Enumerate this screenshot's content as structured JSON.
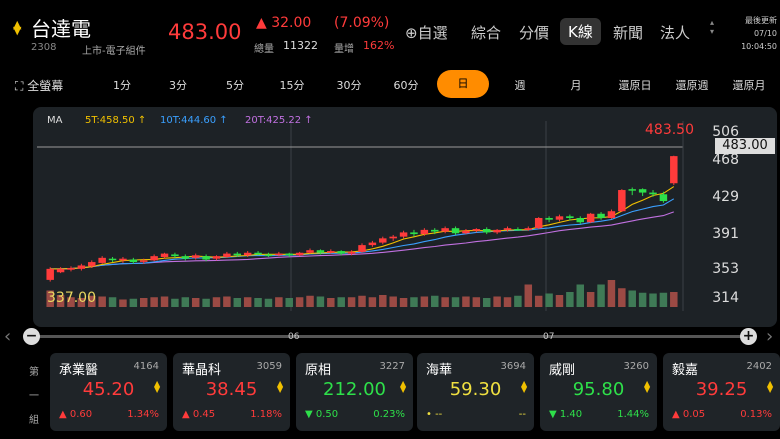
{
  "header": {
    "name": "台達電",
    "code": "2308",
    "market": "上市-電子組件",
    "price": "483.00",
    "change": "▲ 32.00",
    "change_pct": "(7.09%)",
    "volume_label": "總量",
    "volume": "11322",
    "ratio_label": "量增",
    "ratio": "162%",
    "nav": [
      "⊕自選",
      "綜合",
      "分價",
      "K線",
      "新聞",
      "法人"
    ],
    "update_label": "最後更新",
    "update_date": "07/10",
    "update_time": "10:04:50"
  },
  "timeframes": {
    "fullscreen": "全螢幕",
    "items": [
      "1分",
      "3分",
      "5分",
      "15分",
      "30分",
      "60分",
      "日",
      "週",
      "月",
      "還原日",
      "還原週",
      "還原月"
    ],
    "active": "日"
  },
  "chart_data": {
    "type": "candlestick",
    "indicator_label": "MA",
    "ma": [
      {
        "name": "5T:458.50",
        "color": "#f0c000"
      },
      {
        "name": "10T:444.60",
        "color": "#3aa0ff"
      },
      {
        "name": "20T:425.22",
        "color": "#c070e0"
      }
    ],
    "y_ticks": [
      506,
      468,
      429,
      391,
      353,
      314
    ],
    "ylim": [
      305,
      515
    ],
    "current_price": "483.00",
    "high_label": "483.50",
    "low_label": "337.00",
    "x_labels": [
      "06",
      "07"
    ],
    "candles": [
      [
        337,
        350,
        335,
        352,
        1
      ],
      [
        346,
        350,
        345,
        352,
        1
      ],
      [
        349,
        351,
        347,
        353,
        1
      ],
      [
        350,
        354,
        348,
        356,
        1
      ],
      [
        353,
        358,
        351,
        360,
        1
      ],
      [
        357,
        363,
        356,
        365,
        1
      ],
      [
        362,
        361,
        358,
        364,
        0
      ],
      [
        360,
        362,
        357,
        364,
        1
      ],
      [
        361,
        358,
        356,
        363,
        0
      ],
      [
        359,
        360,
        356,
        362,
        1
      ],
      [
        360,
        365,
        359,
        367,
        1
      ],
      [
        364,
        368,
        362,
        369,
        1
      ],
      [
        367,
        365,
        363,
        369,
        0
      ],
      [
        365,
        362,
        360,
        367,
        0
      ],
      [
        363,
        366,
        361,
        368,
        1
      ],
      [
        365,
        361,
        359,
        367,
        0
      ],
      [
        362,
        365,
        360,
        366,
        1
      ],
      [
        364,
        368,
        363,
        370,
        1
      ],
      [
        368,
        366,
        364,
        370,
        0
      ],
      [
        366,
        369,
        364,
        371,
        1
      ],
      [
        369,
        367,
        366,
        371,
        0
      ],
      [
        367,
        366,
        364,
        369,
        0
      ],
      [
        366,
        368,
        365,
        370,
        1
      ],
      [
        368,
        366,
        364,
        369,
        0
      ],
      [
        366,
        369,
        365,
        370,
        1
      ],
      [
        369,
        372,
        368,
        374,
        1
      ],
      [
        372,
        369,
        367,
        373,
        0
      ],
      [
        369,
        371,
        368,
        373,
        1
      ],
      [
        371,
        368,
        366,
        372,
        0
      ],
      [
        368,
        370,
        366,
        372,
        1
      ],
      [
        370,
        378,
        369,
        380,
        1
      ],
      [
        378,
        381,
        376,
        383,
        1
      ],
      [
        381,
        386,
        379,
        388,
        1
      ],
      [
        386,
        388,
        383,
        390,
        1
      ],
      [
        388,
        393,
        386,
        395,
        1
      ],
      [
        393,
        391,
        388,
        396,
        0
      ],
      [
        391,
        396,
        389,
        398,
        1
      ],
      [
        396,
        394,
        391,
        398,
        0
      ],
      [
        394,
        398,
        392,
        400,
        1
      ],
      [
        398,
        392,
        390,
        400,
        0
      ],
      [
        392,
        395,
        391,
        397,
        1
      ],
      [
        395,
        397,
        393,
        398,
        1
      ],
      [
        397,
        393,
        391,
        399,
        0
      ],
      [
        393,
        396,
        391,
        397,
        1
      ],
      [
        396,
        398,
        394,
        400,
        1
      ],
      [
        397,
        396,
        395,
        399,
        0
      ],
      [
        396,
        398,
        395,
        400,
        1
      ],
      [
        398,
        410,
        397,
        411,
        1
      ],
      [
        410,
        408,
        405,
        412,
        0
      ],
      [
        408,
        412,
        406,
        414,
        1
      ],
      [
        412,
        410,
        407,
        414,
        0
      ],
      [
        410,
        405,
        403,
        412,
        0
      ],
      [
        405,
        415,
        404,
        416,
        1
      ],
      [
        415,
        410,
        408,
        417,
        0
      ],
      [
        410,
        418,
        409,
        420,
        1
      ],
      [
        418,
        443,
        417,
        444,
        1
      ],
      [
        443,
        444,
        437,
        446,
        0
      ],
      [
        444,
        440,
        436,
        445,
        0
      ],
      [
        440,
        438,
        435,
        443,
        0
      ],
      [
        438,
        430,
        428,
        441,
        0
      ],
      [
        451,
        483,
        449,
        483.5,
        1
      ]
    ],
    "volumes": [
      22,
      16,
      13,
      12,
      15,
      14,
      13,
      10,
      11,
      12,
      13,
      14,
      11,
      13,
      12,
      11,
      13,
      14,
      12,
      13,
      12,
      11,
      13,
      12,
      13,
      15,
      14,
      12,
      13,
      13,
      15,
      13,
      16,
      14,
      12,
      13,
      14,
      15,
      13,
      13,
      14,
      13,
      12,
      14,
      13,
      15,
      30,
      15,
      18,
      16,
      20,
      30,
      20,
      30,
      36,
      25,
      22,
      19,
      18,
      19,
      20
    ]
  },
  "scroll": {
    "minus": "−",
    "plus": "+",
    "left_arrow": "‹",
    "right_arrow": "›"
  },
  "group": {
    "label": "第 一 組"
  },
  "cards": [
    {
      "name": "承業醫",
      "code": "4164",
      "price": "45.20",
      "change": "▲ 0.60",
      "pct": "1.34%",
      "color": "red",
      "name_color": "white"
    },
    {
      "name": "華晶科",
      "code": "3059",
      "price": "38.45",
      "change": "▲ 0.45",
      "pct": "1.18%",
      "color": "red",
      "name_color": "white"
    },
    {
      "name": "原相",
      "code": "3227",
      "price": "212.00",
      "change": "▼ 0.50",
      "pct": "0.23%",
      "color": "green",
      "name_color": "white"
    },
    {
      "name": "海華",
      "code": "3694",
      "price": "59.30",
      "change": "•  --",
      "pct": "--",
      "color": "yellow",
      "name_color": "white"
    },
    {
      "name": "威剛",
      "code": "3260",
      "price": "95.80",
      "change": "▼ 1.40",
      "pct": "1.44%",
      "color": "green",
      "name_color": "red"
    },
    {
      "name": "毅嘉",
      "code": "2402",
      "price": "39.25",
      "change": "▲ 0.05",
      "pct": "0.13%",
      "color": "red",
      "name_color": "white"
    }
  ]
}
